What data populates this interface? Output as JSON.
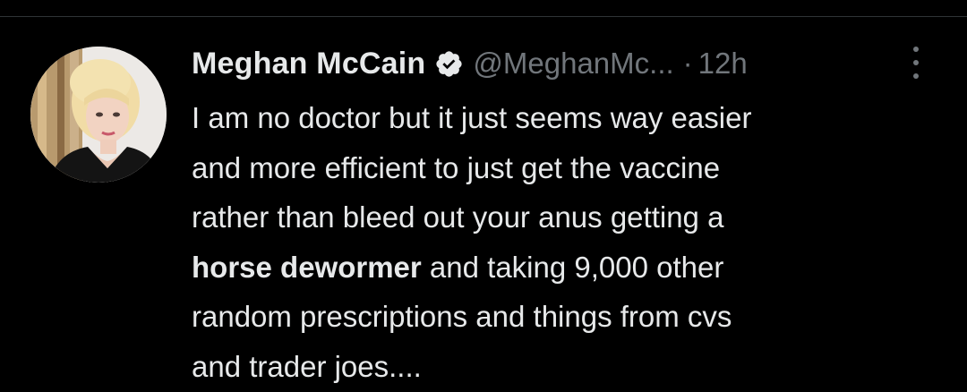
{
  "tweet": {
    "author": {
      "display_name": "Meghan McCain",
      "verified_icon": "verified-badge-icon",
      "handle": "@MeghanMc...",
      "separator": "·",
      "time": "12h"
    },
    "more_icon": "more-options-icon",
    "text": {
      "line1": "I am no doctor but it just seems way easier",
      "line2": "and more efficient to just get the vaccine",
      "line3": "rather than bleed out your anus getting a",
      "line4_bold": "horse dewormer",
      "line4_rest": " and taking 9,000 other",
      "line5": "random prescriptions and things from cvs",
      "line6": "and trader joes...."
    }
  },
  "colors": {
    "background": "#000000",
    "primary_text": "#e7e9ea",
    "secondary_text": "#71767b",
    "divider": "#2f3336"
  }
}
